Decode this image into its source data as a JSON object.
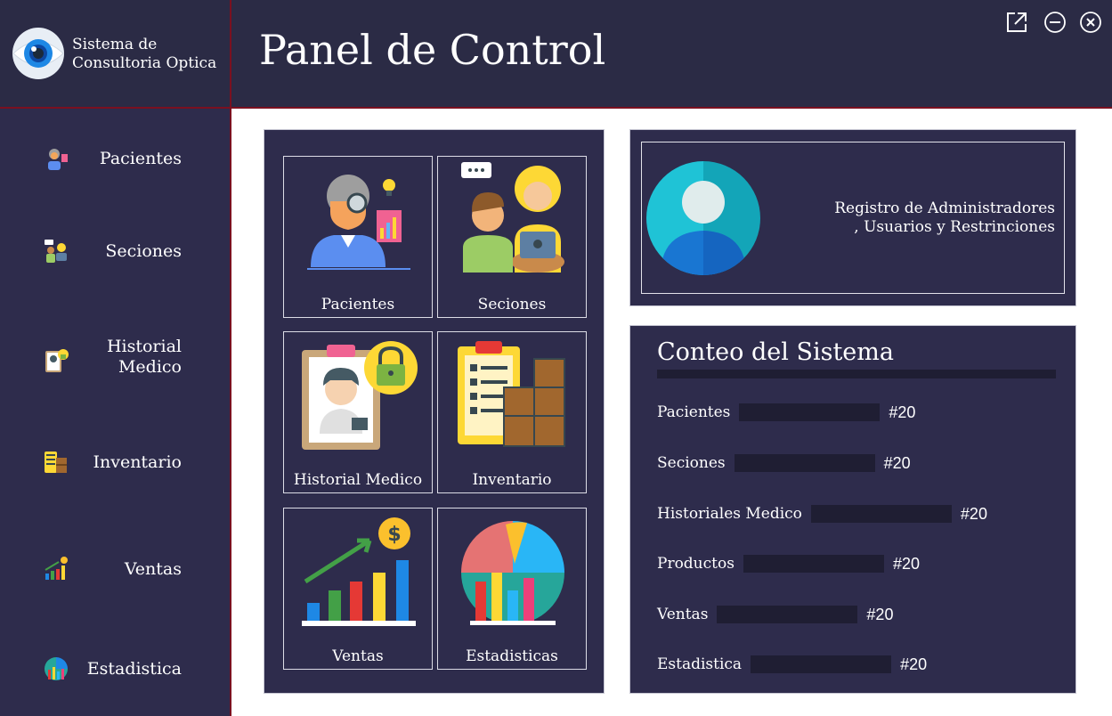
{
  "app": {
    "name_line1": "Sistema de",
    "name_line2": "Consultoria Optica"
  },
  "header": {
    "title": "Panel de Control"
  },
  "window_controls": [
    "external-link-icon",
    "minimize-icon",
    "close-icon"
  ],
  "sidebar": {
    "items": [
      {
        "label": "Pacientes",
        "icon": "patients-icon"
      },
      {
        "label": "Seciones",
        "icon": "sessions-icon"
      },
      {
        "label_line1": "Historial",
        "label_line2": "Medico",
        "icon": "medical-record-icon"
      },
      {
        "label": "Inventario",
        "icon": "inventory-icon"
      },
      {
        "label": "Ventas",
        "icon": "sales-chart-icon"
      },
      {
        "label": "Estadistica",
        "icon": "statistics-icon"
      }
    ]
  },
  "tiles": [
    {
      "label": "Pacientes",
      "icon": "patient-magnifier-icon"
    },
    {
      "label": "Seciones",
      "icon": "consultation-session-icon"
    },
    {
      "label": "Historial Medico",
      "icon": "locked-medical-record-icon"
    },
    {
      "label": "Inventario",
      "icon": "clipboard-boxes-icon"
    },
    {
      "label": "Ventas",
      "icon": "growth-chart-coin-icon"
    },
    {
      "label": "Estadisticas",
      "icon": "pie-bar-chart-icon"
    }
  ],
  "admin": {
    "line1": "Registro de Administradores",
    "line2": ", Usuarios y Restrinciones",
    "icon": "user-avatar-icon"
  },
  "counts": {
    "title": "Conteo del Sistema",
    "rows": [
      {
        "label": "Pacientes",
        "value": "#20"
      },
      {
        "label": "Seciones",
        "value": "#20"
      },
      {
        "label": "Historiales Medico",
        "value": "#20"
      },
      {
        "label": "Productos",
        "value": "#20"
      },
      {
        "label": "Ventas",
        "value": "#20"
      },
      {
        "label": "Estadistica",
        "value": "#20"
      }
    ]
  },
  "colors": {
    "header_bg": "#2b2b45",
    "panel_bg": "#2e2c4c",
    "accent_line": "#7a1020",
    "count_bar": "#1f1e33"
  }
}
